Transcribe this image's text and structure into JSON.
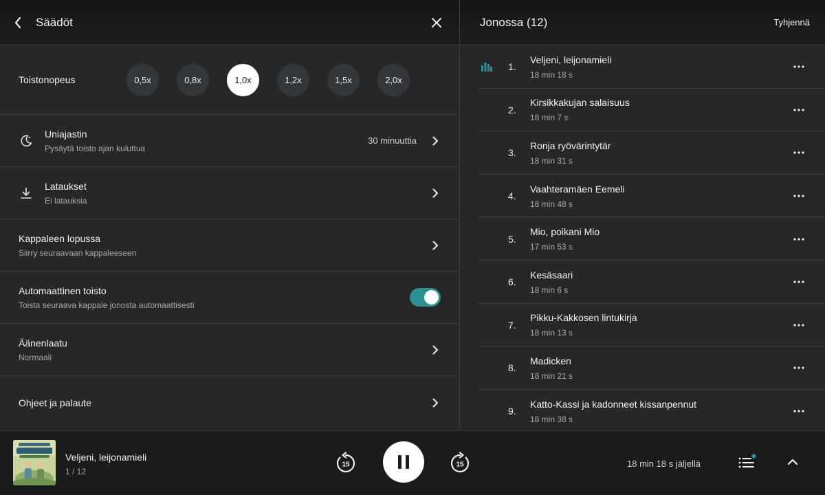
{
  "settings": {
    "title": "Säädöt",
    "speed": {
      "label": "Toistonopeus",
      "options": [
        "0,5x",
        "0,8x",
        "1,0x",
        "1,2x",
        "1,5x",
        "2,0x"
      ],
      "selected": "1,0x"
    },
    "rows": [
      {
        "title": "Uniajastin",
        "subtitle": "Pysäytä toisto ajan kuluttua",
        "value": "30 minuuttia",
        "icon": "moon-icon"
      },
      {
        "title": "Lataukset",
        "subtitle": "Ei latauksia",
        "icon": "download-icon"
      },
      {
        "title": "Kappaleen lopussa",
        "subtitle": "Siirry seuraavaan kappaleeseen"
      },
      {
        "title": "Automaattinen toisto",
        "subtitle": "Toista seuraava kappale jonosta automaattisesti",
        "toggle_on": true
      },
      {
        "title": "Äänenlaatu",
        "subtitle": "Normaali"
      },
      {
        "title": "Ohjeet ja palaute"
      }
    ]
  },
  "queue": {
    "title": "Jonossa (12)",
    "clear_label": "Tyhjennä",
    "items": [
      {
        "num": "1.",
        "title": "Veljeni, leijonamieli",
        "duration": "18 min 18 s",
        "playing": true
      },
      {
        "num": "2.",
        "title": "Kirsikkakujan salaisuus",
        "duration": "18 min 7 s"
      },
      {
        "num": "3.",
        "title": "Ronja ryövärintytär",
        "duration": "18 min 31 s"
      },
      {
        "num": "4.",
        "title": "Vaahteramäen Eemeli",
        "duration": "18 min 48 s"
      },
      {
        "num": "5.",
        "title": "Mio, poikani Mio",
        "duration": "17 min 53 s"
      },
      {
        "num": "6.",
        "title": "Kesäsaari",
        "duration": "18 min 6 s"
      },
      {
        "num": "7.",
        "title": "Pikku-Kakkosen lintukirja",
        "duration": "18 min 13 s"
      },
      {
        "num": "8.",
        "title": "Madicken",
        "duration": "18 min 21 s"
      },
      {
        "num": "9.",
        "title": "Katto-Kassi ja kadonneet kissanpennut",
        "duration": "18 min 38 s"
      }
    ]
  },
  "player": {
    "title": "Veljeni, leijonamieli",
    "position": "1 / 12",
    "skip_back_seconds": "15",
    "skip_forward_seconds": "15",
    "remaining": "18 min 18 s jäljellä"
  },
  "colors": {
    "accent": "#2b8f93",
    "background": "#252729",
    "header": "#18191b",
    "player": "#1a1b1d"
  }
}
